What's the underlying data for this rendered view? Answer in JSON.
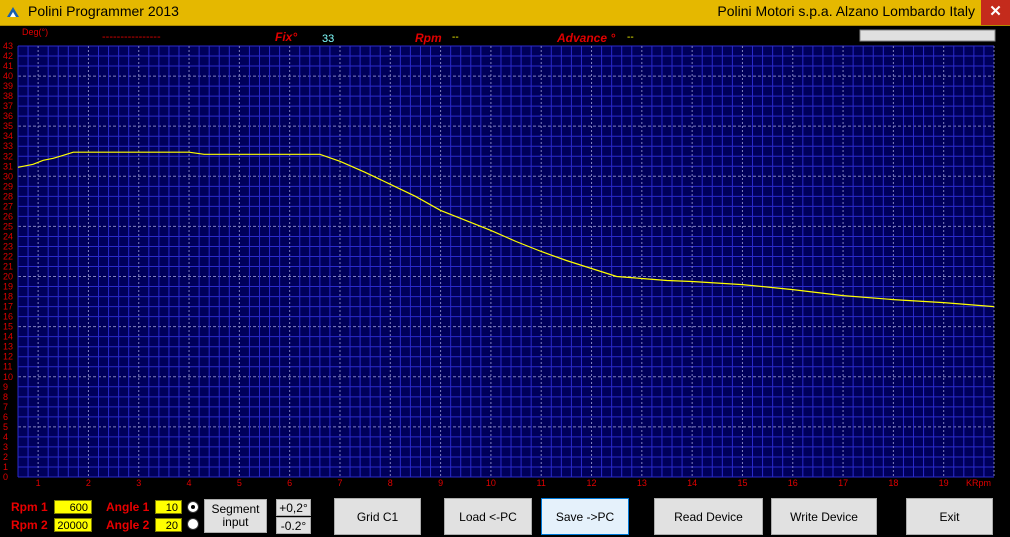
{
  "window": {
    "title": "Polini Programmer 2013",
    "company": "Polini Motori s.p.a.  Alzano Lombardo Italy",
    "close_glyph": "✕"
  },
  "status": {
    "dashes": "----------------",
    "fix_label": "Fix°",
    "fix_value": "33",
    "rpm_label": "Rpm",
    "rpm_value": "--",
    "advance_label": "Advance °",
    "advance_value": "--"
  },
  "controls": {
    "rpm1_label": "Rpm 1",
    "rpm1_value": "600",
    "rpm2_label": "Rpm 2",
    "rpm2_value": "20000",
    "angle1_label": "Angle 1",
    "angle1_value": "10",
    "angle2_label": "Angle 2",
    "angle2_value": "20",
    "segment_input_label": "Segment input",
    "plus_label": "+0,2°",
    "minus_label": "-0.2°",
    "grid_label": "Grid C1",
    "load_label": "Load <-PC",
    "save_label": "Save  ->PC",
    "read_label": "Read Device",
    "write_label": "Write Device",
    "exit_label": "Exit"
  },
  "colors": {
    "plot_bg": "#00005a",
    "grid_minor": "#2a2acb",
    "grid_major": "#8080c0",
    "axis_text": "#e00000",
    "curve": "#ffff00",
    "titlebar": "#e5b800"
  },
  "chart_data": {
    "type": "line",
    "xlabel": "KRpm",
    "ylabel": "Deg(°)",
    "xlim": [
      0.6,
      20.0
    ],
    "ylim": [
      0,
      43
    ],
    "x_ticks": [
      1,
      2,
      3,
      4,
      5,
      6,
      7,
      8,
      9,
      10,
      11,
      12,
      13,
      14,
      15,
      16,
      17,
      18,
      19
    ],
    "y_ticks": [
      0,
      1,
      2,
      3,
      4,
      5,
      6,
      7,
      8,
      9,
      10,
      11,
      12,
      13,
      14,
      15,
      16,
      17,
      18,
      19,
      20,
      21,
      22,
      23,
      24,
      25,
      26,
      27,
      28,
      29,
      30,
      31,
      32,
      33,
      34,
      35,
      36,
      37,
      38,
      39,
      40,
      41,
      42,
      43
    ],
    "grid": true,
    "series": [
      {
        "x": [
          0.6,
          0.9,
          1.1,
          1.3,
          1.5,
          1.7,
          2.0,
          3.0,
          4.0,
          4.3,
          5.0,
          6.0,
          6.6,
          7.0,
          7.5,
          8.0,
          8.5,
          9.0,
          9.5,
          10.0,
          10.5,
          11.0,
          11.5,
          12.0,
          12.5,
          13.0,
          13.5,
          14.0,
          15.0,
          16.0,
          17.0,
          18.0,
          19.0,
          19.5,
          20.0
        ],
        "y": [
          30.9,
          31.2,
          31.6,
          31.8,
          32.1,
          32.4,
          32.4,
          32.4,
          32.4,
          32.2,
          32.2,
          32.2,
          32.2,
          31.5,
          30.4,
          29.2,
          28.0,
          26.6,
          25.6,
          24.6,
          23.5,
          22.5,
          21.6,
          20.8,
          20.0,
          19.8,
          19.6,
          19.5,
          19.2,
          18.7,
          18.1,
          17.7,
          17.4,
          17.2,
          17.0
        ]
      }
    ]
  }
}
